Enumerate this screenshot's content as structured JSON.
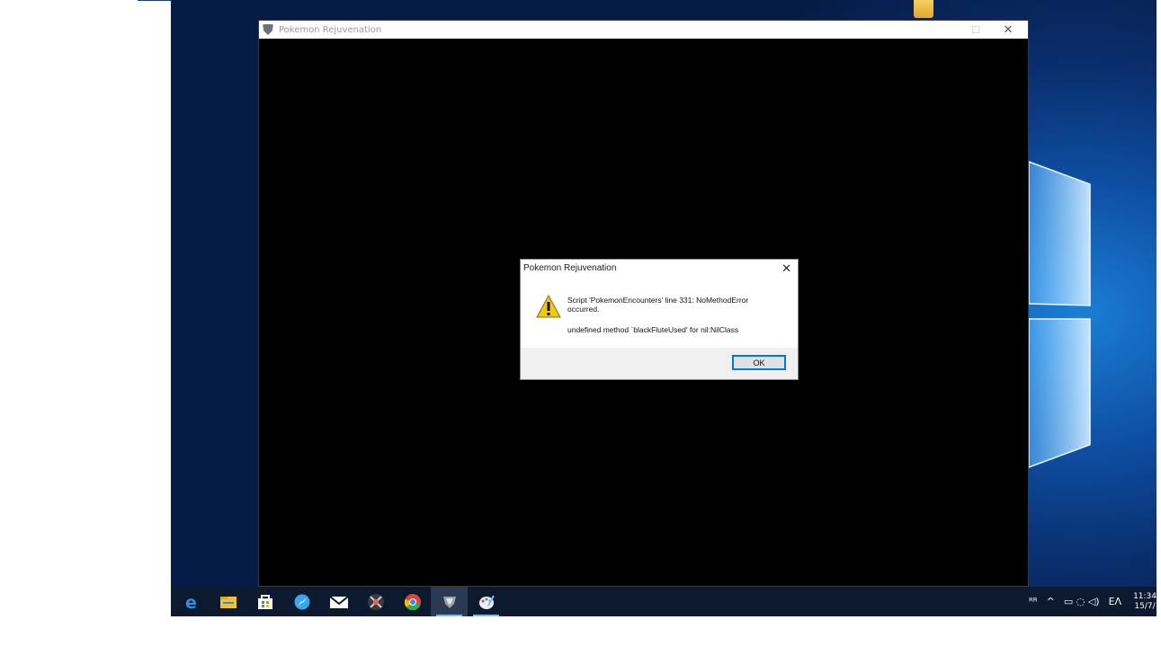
{
  "app_window": {
    "title": "Pokemon Rejuvenation",
    "maximize_glyph": "☐",
    "close_glyph": "✕"
  },
  "dialog": {
    "title": "Pokemon Rejuvenation",
    "close_glyph": "✕",
    "message_line1": "Script 'PokemonEncounters' line 331: NoMethodError",
    "message_line2": "occurred.",
    "detail": "undefined method `blackFluteUsed' for nil:NilClass",
    "ok_label": "OK",
    "icon": "warning-icon"
  },
  "taskbar": {
    "items": [
      {
        "icon": "edge-icon",
        "color": "#2f8fe0"
      },
      {
        "icon": "file-explorer-icon",
        "color": "#f1c232"
      },
      {
        "icon": "store-icon",
        "color": "#ffffff"
      },
      {
        "icon": "safari-like-icon",
        "color": "#38a6f0"
      },
      {
        "icon": "mail-icon",
        "color": "#ffffff"
      },
      {
        "icon": "app-icon-dark",
        "color": "#6b6b6b"
      },
      {
        "icon": "chrome-icon",
        "color": "#e84235"
      },
      {
        "icon": "pokemon-rejuvenation-icon",
        "color": "#c8c8c8"
      },
      {
        "icon": "paint-icon",
        "color": "#8ab4f8"
      }
    ],
    "tray": {
      "people": "ᴿᴿ",
      "chevron": "^",
      "icons": "▭ ◌ ◁)",
      "language": "ΕΛ",
      "time": "11:34",
      "date": "15/7/"
    }
  }
}
